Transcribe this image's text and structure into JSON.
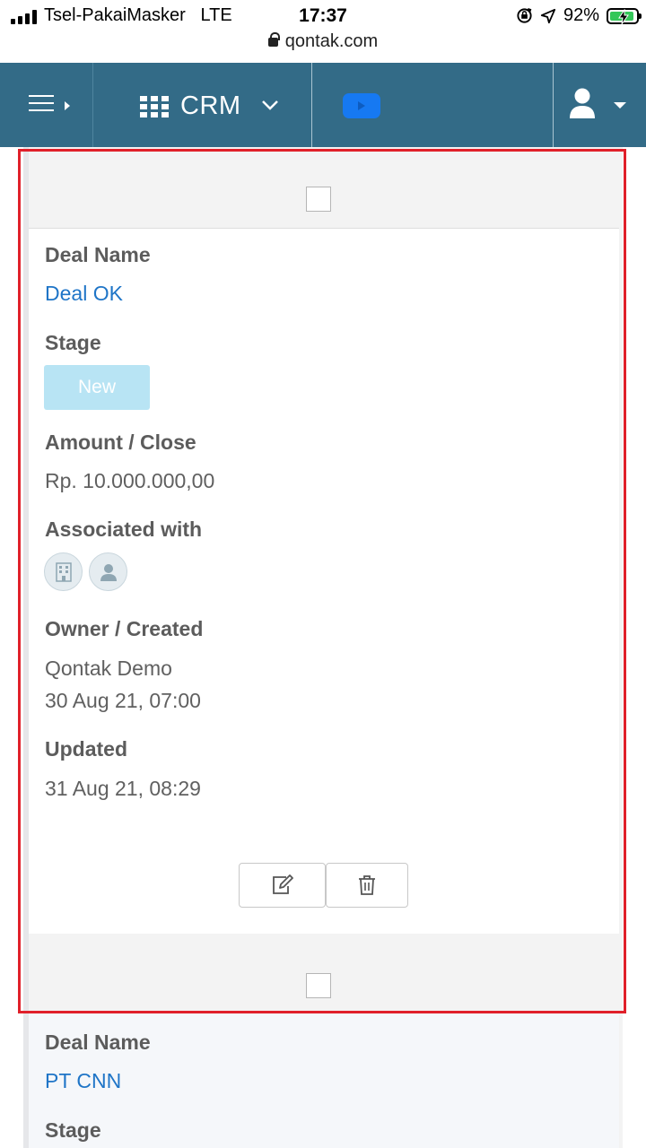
{
  "status_bar": {
    "carrier": "Tsel-PakaiMasker",
    "network": "LTE",
    "time": "17:37",
    "url": "qontak.com",
    "battery_pct": "92%",
    "battery_level": 0.92
  },
  "navbar": {
    "app_label": "CRM",
    "background_color": "#336b87",
    "video_color": "#1679f2"
  },
  "deals": [
    {
      "deal_name_label": "Deal Name",
      "deal_name": "Deal OK",
      "stage_label": "Stage",
      "stage": "New",
      "amount_label": "Amount / Close",
      "amount": "Rp. 10.000.000,00",
      "associated_label": "Associated with",
      "associated_icons": [
        "building-icon",
        "person-icon"
      ],
      "owner_label": "Owner / Created",
      "owner": "Qontak Demo",
      "created": "30 Aug 21, 07:00",
      "updated_label": "Updated",
      "updated": "31 Aug 21, 08:29"
    },
    {
      "deal_name_label": "Deal Name",
      "deal_name": "PT CNN",
      "stage_label": "Stage"
    }
  ],
  "colors": {
    "highlight": "#e0202a",
    "link": "#1f75c7",
    "stage_new_bg": "#b8e4f4"
  }
}
